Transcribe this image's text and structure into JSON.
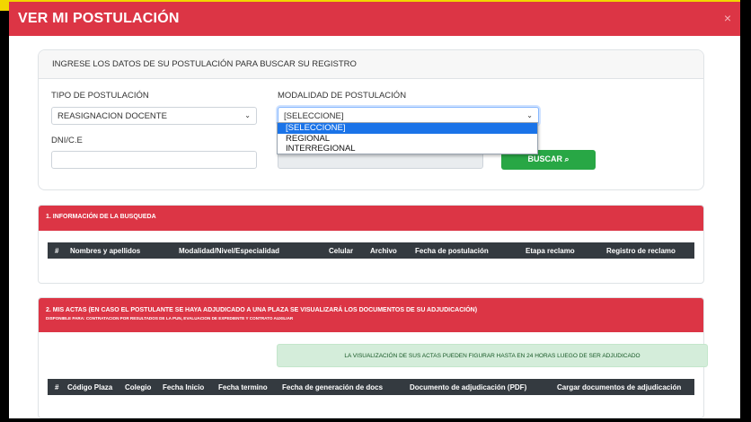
{
  "modal": {
    "title": "VER MI POSTULACIÓN",
    "close": "×"
  },
  "search": {
    "heading": "INGRESE LOS DATOS DE SU POSTULACIÓN PARA BUSCAR SU REGISTRO",
    "tipo_label": "TIPO DE POSTULACIÓN",
    "tipo_value": "REASIGNACION DOCENTE",
    "modalidad_label": "MODALIDAD DE POSTULACIÓN",
    "modalidad_value": "[SELECCIONE]",
    "modalidad_options": [
      "[SELECCIONE]",
      "REGIONAL",
      "INTERREGIONAL"
    ],
    "dni_label": "DNI/C.E",
    "dni_value": "",
    "buscar_label": "BUSCAR",
    "buscar_icon": "⌕"
  },
  "section1": {
    "title": "1. INFORMACIÓN DE LA BUSQUEDA",
    "columns": [
      "#",
      "Nombres y apellidos",
      "Modalidad/Nivel/Especialidad",
      "Celular",
      "Archivo",
      "Fecha de postulación",
      "Etapa reclamo",
      "Registro de reclamo"
    ]
  },
  "section2": {
    "title": "2. MIS ACTAS (EN CASO EL POSTULANTE SE HAYA ADJUDICADO A UNA PLAZA SE VISUALIZARÁ LOS DOCUMENTOS DE SU ADJUDICACIÓN)",
    "subtitle": "DISPONIBLE PARA: CONTRATACION POR RESULTADOS DE LA PUN, EVALUACION DE EXPEDIENTE Y CONTRATO AUXILIAR",
    "alert": "LA VISUALIZACIÓN DE SUS ACTAS PUEDEN FIGURAR HASTA EN 24 HORAS LUEGO DE SER ADJUDICADO",
    "columns": [
      "#",
      "Código Plaza",
      "Colegio",
      "Fecha Inicio",
      "Fecha termino",
      "Fecha de generación de docs",
      "Documento de adjudicación (PDF)",
      "Cargar documentos de adjudicación"
    ]
  },
  "colors": {
    "header_red": "#dc3545",
    "button_green": "#28a745",
    "table_head": "#343a40",
    "alert_bg": "#d4edda"
  }
}
